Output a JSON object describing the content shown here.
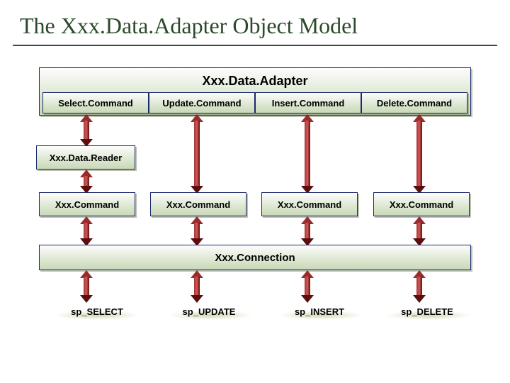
{
  "title": "The Xxx.Data.Adapter Object Model",
  "adapter": {
    "label": "Xxx.Data.Adapter",
    "commands": [
      "Select.Command",
      "Update.Command",
      "Insert.Command",
      "Delete.Command"
    ]
  },
  "reader": "Xxx.Data.Reader",
  "xxxCommand": "Xxx.Command",
  "connection": "Xxx.Connection",
  "sp": [
    "sp_SELECT",
    "sp_UPDATE",
    "sp_INSERT",
    "sp_DELETE"
  ],
  "colors": {
    "titleText": "#2a4a2a",
    "boxBorder": "#1a2a6a",
    "arrow": "#9a2b2b"
  }
}
